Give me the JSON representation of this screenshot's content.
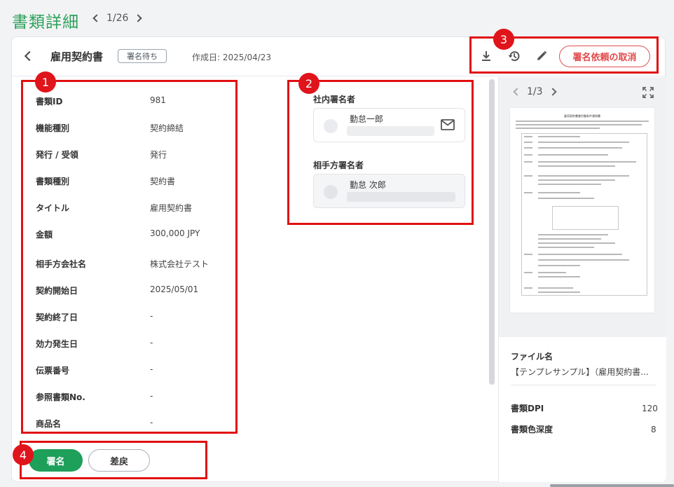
{
  "page": {
    "title": "書類詳細",
    "pager": "1/26"
  },
  "header": {
    "doc_title": "雇用契約書",
    "status": "署名待ち",
    "created_date": "作成日: 2025/04/23",
    "cancel_button": "署名依頼の取消",
    "icons": [
      "download-icon",
      "history-icon",
      "edit-icon"
    ]
  },
  "fields": [
    {
      "label": "書類ID",
      "value": "981"
    },
    {
      "label": "機能種別",
      "value": "契約締結"
    },
    {
      "label": "発行 / 受領",
      "value": "発行"
    },
    {
      "label": "書類種別",
      "value": "契約書"
    },
    {
      "label": "タイトル",
      "value": "雇用契約書"
    },
    {
      "label": "金額",
      "value": "300,000 JPY"
    },
    {
      "label": "相手方会社名",
      "value": "株式会社テスト"
    },
    {
      "label": "契約開始日",
      "value": "2025/05/01"
    },
    {
      "label": "契約終了日",
      "value": "-"
    },
    {
      "label": "効力発生日",
      "value": "-"
    },
    {
      "label": "伝票番号",
      "value": "-"
    },
    {
      "label": "参照書類No.",
      "value": "-"
    },
    {
      "label": "商品名",
      "value": "-"
    }
  ],
  "signers": {
    "internal_label": "社内署名者",
    "internal_name": "勤怠一郎",
    "counterparty_label": "相手方署名者",
    "counterparty_name": "勤怠 次郎"
  },
  "preview": {
    "pager": "1/3",
    "doc_heading": "雇用契約書兼労働条件通知書"
  },
  "file_info": {
    "filename_label": "ファイル名",
    "filename_value": "【テンプレサンプル】（雇用契約書...",
    "dpi_label": "書類DPI",
    "dpi_value": "120",
    "color_depth_label": "書類色深度",
    "color_depth_value": "8"
  },
  "actions": {
    "sign": "署名",
    "return": "差戻"
  },
  "callouts": [
    "1",
    "2",
    "3",
    "4"
  ],
  "colors": {
    "accent_green": "#2ea15a",
    "sign_button": "#1e9f5a",
    "callout_red": "#e01010",
    "cancel_red": "#e04848"
  }
}
